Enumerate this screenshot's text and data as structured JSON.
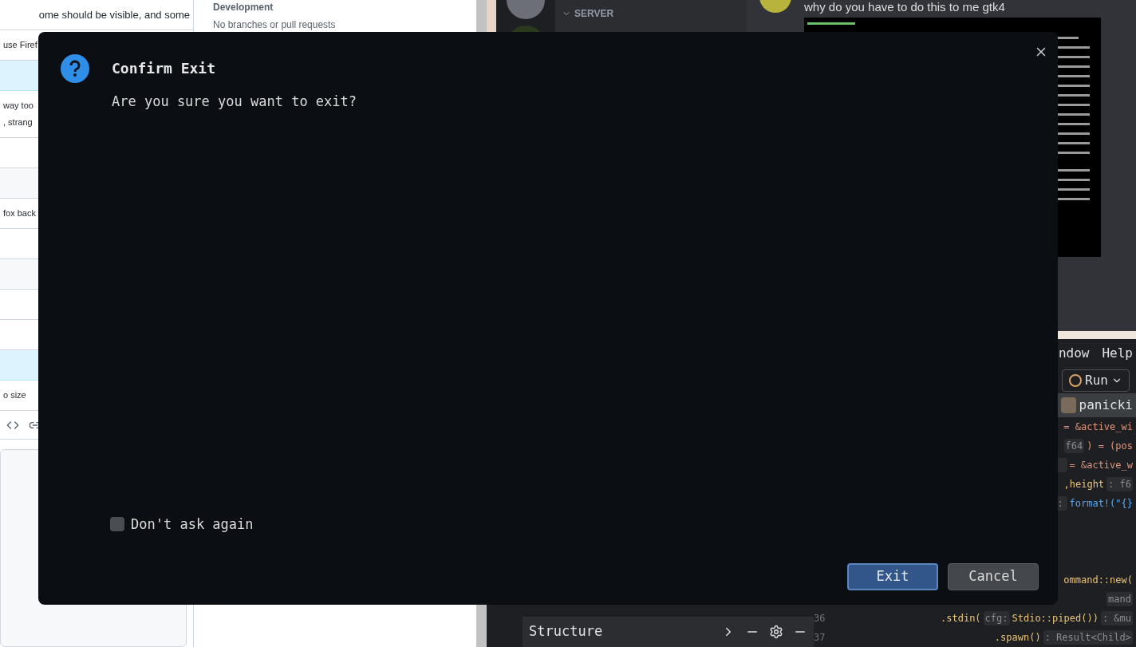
{
  "browser": {
    "fragments": [
      {
        "text": "ome should be visible, and some",
        "kind": "plain"
      },
      {
        "text": "use Firef",
        "kind": "plain"
      },
      {
        "kind": "highlight"
      },
      {
        "text": "way too\n, strang",
        "kind": "plain"
      },
      {
        "kind": "plain"
      },
      {
        "kind": "shaded"
      },
      {
        "text": "fox back",
        "kind": "plain"
      },
      {
        "kind": "plain"
      },
      {
        "kind": "shaded"
      },
      {
        "kind": "plain"
      },
      {
        "kind": "plain"
      },
      {
        "kind": "highlight"
      },
      {
        "text": "o size",
        "kind": "plain"
      }
    ],
    "sidebar": {
      "heading": "Development",
      "text": "No branches or pull requests"
    }
  },
  "chat": {
    "section": "SERVER",
    "message": "why do you have to do this to me gtk4"
  },
  "ide": {
    "menu": [
      "ndow",
      "Help"
    ],
    "run_button": "Run",
    "tab": "panicki",
    "lines": [
      {
        "tokens": [
          {
            "text": "= &active_wi",
            "kind": "op"
          }
        ]
      },
      {
        "tokens": [
          {
            "text": "f64",
            "kind": "hint"
          },
          {
            "text": ") = (pos",
            "kind": "op"
          }
        ]
      },
      {
        "tokens": [
          {
            "kind": "hint"
          },
          {
            "text": "= &active_w",
            "kind": "op"
          }
        ]
      },
      {
        "tokens": [
          {
            "text": ",height",
            "kind": "ident"
          },
          {
            "text": ": f6",
            "kind": "hint"
          }
        ]
      },
      {
        "tokens": [
          {
            "text": ":",
            "kind": "hint"
          },
          {
            "text": "format!(\"{}",
            "kind": "func"
          }
        ]
      }
    ],
    "lower_lines": [
      {
        "tokens": [
          {
            "text": "ommand::new(",
            "kind": "type"
          }
        ]
      },
      {
        "tokens": [
          {
            "text": "mand",
            "kind": "hint"
          }
        ]
      },
      {
        "number": "36",
        "tokens": [
          {
            "text": ".stdin(",
            "kind": "ident"
          },
          {
            "text": "cfg:",
            "kind": "hint"
          },
          {
            "text": "Stdio::piped())",
            "kind": "type"
          },
          {
            "text": ": &mu",
            "kind": "hint"
          }
        ]
      },
      {
        "number": "37",
        "tokens": [
          {
            "text": ".spawn()",
            "kind": "ident"
          },
          {
            "text": ": Result<Child>",
            "kind": "hint"
          }
        ]
      }
    ],
    "structure_title": "Structure"
  },
  "dialog": {
    "title": "Confirm Exit",
    "message": "Are you sure you want to exit?",
    "dont_ask": {
      "label": "Don't ask again",
      "checked": false
    },
    "buttons": [
      {
        "label": "Exit",
        "selected": true
      },
      {
        "label": "Cancel",
        "selected": false
      }
    ]
  }
}
